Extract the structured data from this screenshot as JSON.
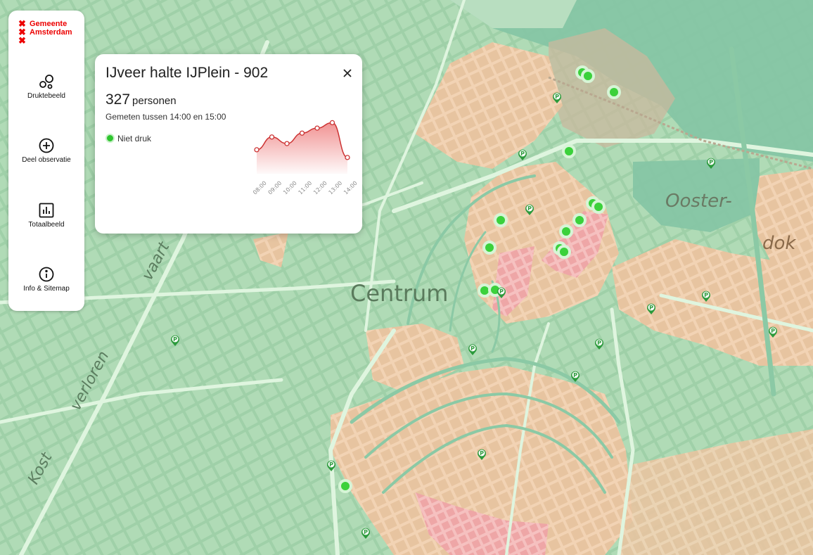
{
  "logo": {
    "line1": "Gemeente",
    "line2": "Amsterdam",
    "color": "#ec0000"
  },
  "sidebar": {
    "items": [
      {
        "label": "Druktebeeld",
        "icon": "circles-icon"
      },
      {
        "label": "Deel observatie",
        "icon": "plus-circle-icon"
      },
      {
        "label": "Totaalbeeld",
        "icon": "bar-chart-icon"
      },
      {
        "label": "Info & Sitemap",
        "icon": "info-icon"
      }
    ]
  },
  "popup": {
    "title": "IJveer halte IJPlein - 902",
    "count": "327",
    "count_unit": "personen",
    "measured": "Gemeten tussen 14:00 en 15:00",
    "status": "Niet druk",
    "status_color": "#2ec52e"
  },
  "chart_data": {
    "type": "area",
    "categories": [
      "08:00",
      "09:00",
      "10:00",
      "11:00",
      "12:00",
      "13:00",
      "14:00"
    ],
    "series": [
      {
        "values": [
          62,
          95,
          78,
          105,
          118,
          132,
          42
        ]
      }
    ],
    "ylim": [
      0,
      200
    ],
    "grid": false,
    "line_color": "#cc3333"
  },
  "map": {
    "labels": [
      "Centrum",
      "Ooster-",
      "dok",
      "Kost",
      "verloren",
      "vaart"
    ],
    "colors": {
      "quiet_area": "#c6e9c8",
      "busy_area": "#eec8a2",
      "very_busy_area": "#f1aeb0",
      "water": "#8cc8a8"
    }
  }
}
